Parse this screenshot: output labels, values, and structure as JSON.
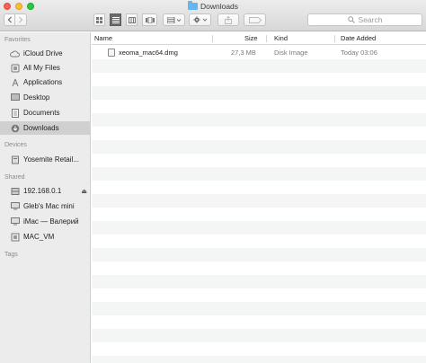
{
  "window": {
    "title": "Downloads"
  },
  "toolbar": {
    "back_icon": "chevron-left",
    "forward_icon": "chevron-right",
    "view_modes": [
      "icon-view",
      "list-view",
      "column-view",
      "cover-flow-view"
    ],
    "active_view": "list-view",
    "search_placeholder": "Search"
  },
  "sidebar": {
    "sections": [
      {
        "title": "Favorites",
        "items": [
          {
            "label": "iCloud Drive",
            "icon": "cloud-icon"
          },
          {
            "label": "All My Files",
            "icon": "all-files-icon"
          },
          {
            "label": "Applications",
            "icon": "applications-icon"
          },
          {
            "label": "Desktop",
            "icon": "desktop-icon"
          },
          {
            "label": "Documents",
            "icon": "documents-icon"
          },
          {
            "label": "Downloads",
            "icon": "downloads-icon",
            "active": true
          }
        ]
      },
      {
        "title": "Devices",
        "items": [
          {
            "label": "Yosemite Retail...",
            "icon": "disk-icon"
          }
        ]
      },
      {
        "title": "Shared",
        "items": [
          {
            "label": "192.168.0.1",
            "icon": "server-icon",
            "eject": true
          },
          {
            "label": "Gleb's Mac mini",
            "icon": "mac-mini-icon"
          },
          {
            "label": "iMac — Валерий",
            "icon": "imac-icon"
          },
          {
            "label": "MAC_VM",
            "icon": "vm-icon"
          }
        ]
      },
      {
        "title": "Tags",
        "items": []
      }
    ]
  },
  "columns": {
    "name": "Name",
    "size": "Size",
    "kind": "Kind",
    "date_added": "Date Added"
  },
  "files": [
    {
      "name": "xeoma_mac64.dmg",
      "size": "27,3 MB",
      "kind": "Disk Image",
      "date_added": "Today 03:06",
      "icon": "disk-image-icon"
    }
  ]
}
